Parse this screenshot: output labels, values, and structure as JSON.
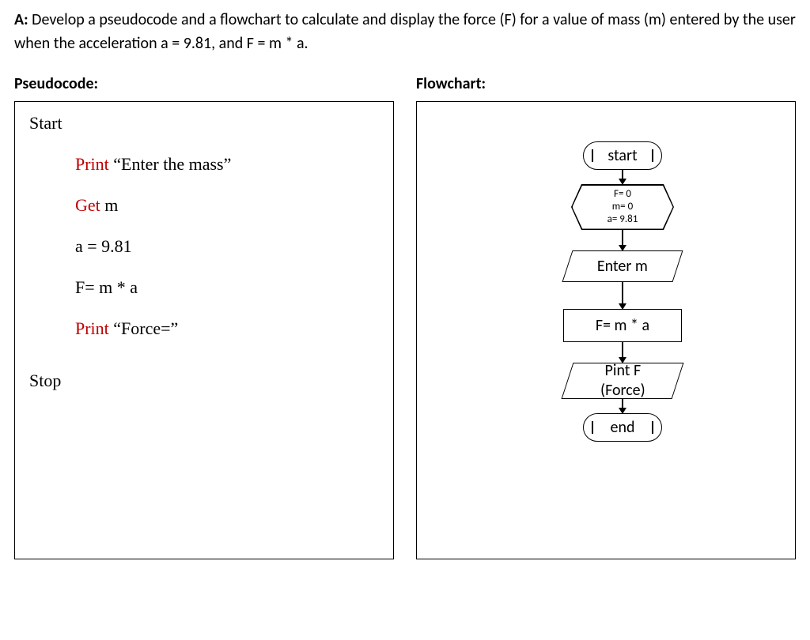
{
  "question": {
    "label": "A:",
    "text": "Develop a pseudocode and a flowchart to calculate and display the force (F) for a value of mass (m) entered by the user when the acceleration a = 9.81, and   F = m * a."
  },
  "pseudocode": {
    "title": "Pseudocode:",
    "start": "Start",
    "stop": "Stop",
    "lines": {
      "print1_kw": "Print",
      "print1_text": " “Enter the mass”",
      "get_kw": "Get",
      "get_text": " m",
      "assign_a": "a = 9.81",
      "assign_f": "F= m * a",
      "print2_kw": "Print",
      "print2_text": " “Force=”"
    }
  },
  "flowchart": {
    "title": "Flowchart:",
    "start": "start",
    "init": "F= 0\nm= 0\na= 9.81",
    "input": "Enter m",
    "process": "F= m * a",
    "output": "Pint F\n(Force)",
    "end": "end"
  }
}
